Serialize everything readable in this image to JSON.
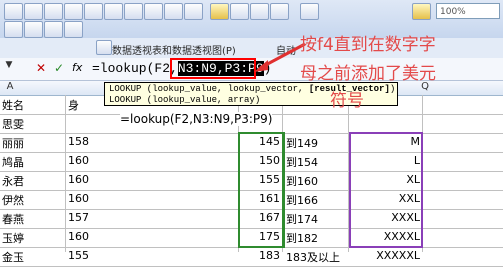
{
  "toolbar": {
    "zoom": "100%",
    "pivot_menu": "数据透视表和数据透视图(P)",
    "auto_label": "自动"
  },
  "formula_bar": {
    "name_box_icon": "dropdown-arrow",
    "cancel": "✕",
    "enter": "✓",
    "fx": "fx",
    "prefix": "=lookup(F2,",
    "highlight": "N3:N9,P3:P9",
    "suffix": ")"
  },
  "tooltip": {
    "line1_a": "LOOKUP (lookup_value, lookup_vector, ",
    "line1_b": "[result_vector]",
    "line1_c": ")",
    "line2": "LOOKUP (lookup_value, array)"
  },
  "columns": {
    "a": "A",
    "q": "Q"
  },
  "cell_formula": "=lookup(F2,N3:N9,P3:P9)",
  "annotation": {
    "line1": "按f4直到在数字字",
    "line2": "母之前添加了美元",
    "line3": "符号"
  },
  "rows": [
    {
      "name": "姓名",
      "score": "身",
      "n": "",
      "o": "",
      "p": ""
    },
    {
      "name": "思雯",
      "score": "",
      "n": "",
      "o": "",
      "p": ""
    },
    {
      "name": "丽丽",
      "score": "158",
      "n": "145",
      "o": "到149",
      "p": "M"
    },
    {
      "name": "鸠晶",
      "score": "160",
      "n": "150",
      "o": "到154",
      "p": "L"
    },
    {
      "name": "永君",
      "score": "160",
      "n": "155",
      "o": "到160",
      "p": "XL"
    },
    {
      "name": "伊然",
      "score": "160",
      "n": "161",
      "o": "到166",
      "p": "XXL"
    },
    {
      "name": "春燕",
      "score": "157",
      "n": "167",
      "o": "到174",
      "p": "XXXL"
    },
    {
      "name": "玉婷",
      "score": "160",
      "n": "175",
      "o": "到182",
      "p": "XXXXL"
    },
    {
      "name": "金玉",
      "score": "155",
      "n": "183",
      "o": "183及以上",
      "p": "XXXXXL"
    }
  ]
}
